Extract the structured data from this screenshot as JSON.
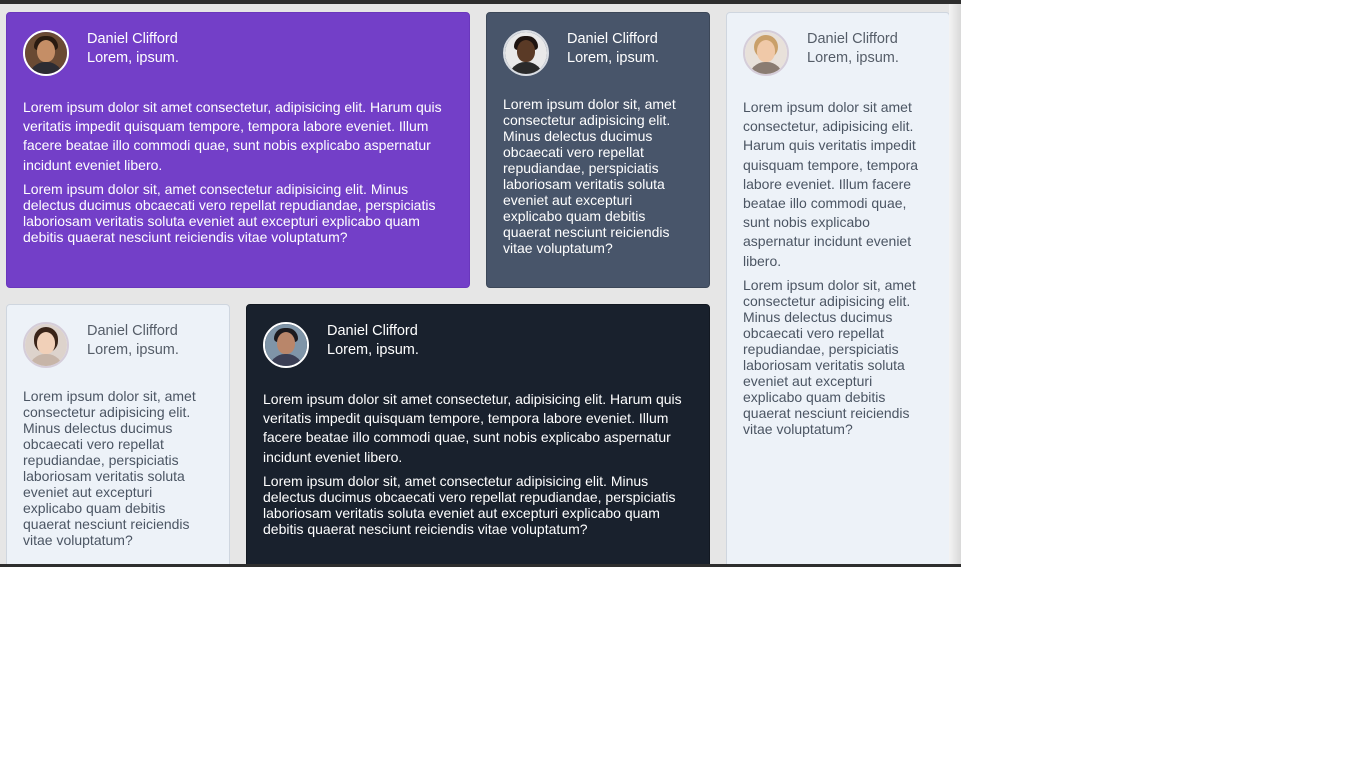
{
  "cards": [
    {
      "name": "Daniel Clifford",
      "role": "Lorem, ipsum.",
      "p1": "Lorem ipsum dolor sit amet consectetur, adipisicing elit. Harum quis veritatis impedit quisquam tempore, tempora labore eveniet. Illum facere beatae illo commodi quae, sunt nobis explicabo aspernatur incidunt eveniet libero.",
      "p2": "Lorem ipsum dolor sit, amet consectetur adipisicing elit. Minus delectus ducimus obcaecati vero repellat repudiandae, perspiciatis laboriosam veritatis soluta eveniet aut excepturi explicabo quam debitis quaerat nesciunt reiciendis vitae voluptatum?",
      "avatar_icon": "man-portrait-icon",
      "color": "#733fc8"
    },
    {
      "name": "Daniel Clifford",
      "role": "Lorem, ipsum.",
      "p2": "Lorem ipsum dolor sit, amet consectetur adipisicing elit. Minus delectus ducimus obcaecati vero repellat repudiandae, perspiciatis laboriosam veritatis soluta eveniet aut excepturi explicabo quam debitis quaerat nesciunt reiciendis vitae voluptatum?",
      "avatar_icon": "man-portrait-icon",
      "color": "#48556a"
    },
    {
      "name": "Daniel Clifford",
      "role": "Lorem, ipsum.",
      "p1": "Lorem ipsum dolor sit amet consectetur, adipisicing elit. Harum quis veritatis impedit quisquam tempore, tempora labore eveniet. Illum facere beatae illo commodi quae, sunt nobis explicabo aspernatur incidunt eveniet libero.",
      "p2": "Lorem ipsum dolor sit, amet consectetur adipisicing elit. Minus delectus ducimus obcaecati vero repellat repudiandae, perspiciatis laboriosam veritatis soluta eveniet aut excepturi explicabo quam debitis quaerat nesciunt reiciendis vitae voluptatum?",
      "avatar_icon": "woman-portrait-icon",
      "color": "#edf2f8"
    },
    {
      "name": "Daniel Clifford",
      "role": "Lorem, ipsum.",
      "p2": "Lorem ipsum dolor sit, amet consectetur adipisicing elit. Minus delectus ducimus obcaecati vero repellat repudiandae, perspiciatis laboriosam veritatis soluta eveniet aut excepturi explicabo quam debitis quaerat nesciunt reiciendis vitae voluptatum?",
      "avatar_icon": "woman-portrait-icon",
      "color": "#edf2f8"
    },
    {
      "name": "Daniel Clifford",
      "role": "Lorem, ipsum.",
      "p1": "Lorem ipsum dolor sit amet consectetur, adipisicing elit. Harum quis veritatis impedit quisquam tempore, tempora labore eveniet. Illum facere beatae illo commodi quae, sunt nobis explicabo aspernatur incidunt eveniet libero.",
      "p2": "Lorem ipsum dolor sit, amet consectetur adipisicing elit. Minus delectus ducimus obcaecati vero repellat repudiandae, perspiciatis laboriosam veritatis soluta eveniet aut excepturi explicabo quam debitis quaerat nesciunt reiciendis vitae voluptatum?",
      "avatar_icon": "man-portrait-icon",
      "color": "#19212d"
    }
  ]
}
